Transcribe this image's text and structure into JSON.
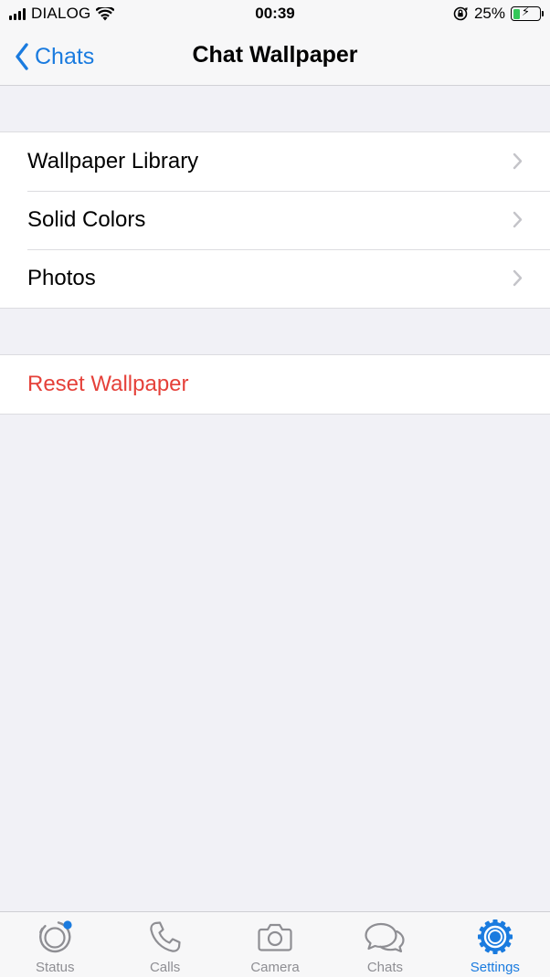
{
  "status_bar": {
    "carrier": "DIALOG",
    "time": "00:39",
    "battery_percent": "25%",
    "battery_level": 0.25
  },
  "nav": {
    "back_label": "Chats",
    "title": "Chat Wallpaper"
  },
  "wallpaper_options": [
    {
      "label": "Wallpaper Library"
    },
    {
      "label": "Solid Colors"
    },
    {
      "label": "Photos"
    }
  ],
  "reset": {
    "label": "Reset Wallpaper",
    "color": "#e5413a"
  },
  "tab_bar": {
    "active": "settings",
    "tabs": [
      {
        "id": "status",
        "label": "Status",
        "icon": "status-icon"
      },
      {
        "id": "calls",
        "label": "Calls",
        "icon": "phone-icon"
      },
      {
        "id": "camera",
        "label": "Camera",
        "icon": "camera-icon"
      },
      {
        "id": "chats",
        "label": "Chats",
        "icon": "chat-bubbles-icon"
      },
      {
        "id": "settings",
        "label": "Settings",
        "icon": "gear-icon"
      }
    ]
  },
  "colors": {
    "accent": "#1a7bdf",
    "background": "#f1f1f6",
    "destructive": "#e5413a"
  }
}
